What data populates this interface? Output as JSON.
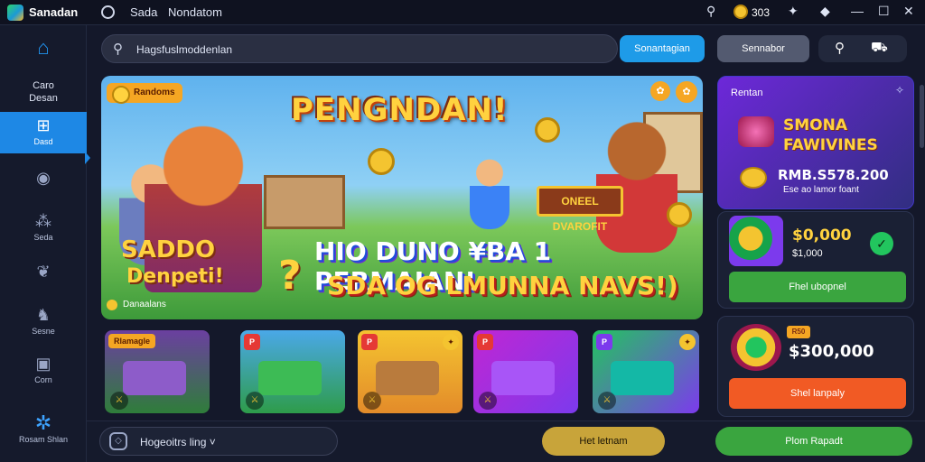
{
  "titlebar": {
    "app_name": "Sanadan",
    "menu_1": "Sada",
    "menu_2": "Nondatom",
    "coins": "303"
  },
  "sidebar": {
    "items": [
      {
        "label": "",
        "icon": "home-icon"
      },
      {
        "label": "Caro\nDesan",
        "icon": "text"
      },
      {
        "label": "Dasd",
        "icon": "add-screen-icon"
      },
      {
        "label": "",
        "icon": "chat-icon"
      },
      {
        "label": "Seda",
        "icon": "apps-icon"
      },
      {
        "label": "",
        "icon": "leaf-icon"
      },
      {
        "label": "Sesne",
        "icon": "users-icon"
      },
      {
        "label": "Corn",
        "icon": "bag-icon"
      },
      {
        "label": "Rosam Shlan",
        "icon": "gear-icon"
      }
    ]
  },
  "search": {
    "value": "Hagsfuslmoddenlan"
  },
  "topbar": {
    "search_button": "Sonantagian",
    "general_button": "Sennabor"
  },
  "hero": {
    "tag": "Randoms",
    "title": "PENGNDAN!",
    "left_line_1": "SADDO",
    "left_line_2": "Denpeti!",
    "question": "?",
    "sign": "ONEEL DVAROFIT",
    "bonus_line_1": "HIO DUNO ¥BA 1 PERMAIAN!",
    "bonus_line_2": "SDA OG LMUNNA NAVS!)",
    "badge": "Danaalans"
  },
  "thumbs": [
    {
      "label": "Rlamagle"
    },
    {
      "label": "P"
    },
    {
      "label": "P"
    },
    {
      "label": "P"
    },
    {
      "label": "P"
    }
  ],
  "promo": {
    "header": "Rentan",
    "title_1": "SMONA",
    "title_2": "FAWIVINES",
    "value": "RMB.S578.200",
    "sub": "Ese ao lamor foant"
  },
  "card1": {
    "value": "$0,000",
    "sub": "$1,000",
    "button": "Fhel ubopnel"
  },
  "card2": {
    "tag": "R50",
    "value": "$300,000",
    "button": "Shel lanpaly"
  },
  "bottombar": {
    "search_value": "Hogeoitrs ling ˅",
    "button_1": "Het letnam",
    "button_2": "Plom Rapadt"
  },
  "colors": {
    "accent": "#1e88e5",
    "success": "#3aa53f",
    "warning": "#f15a24",
    "gold": "#f4c430"
  }
}
